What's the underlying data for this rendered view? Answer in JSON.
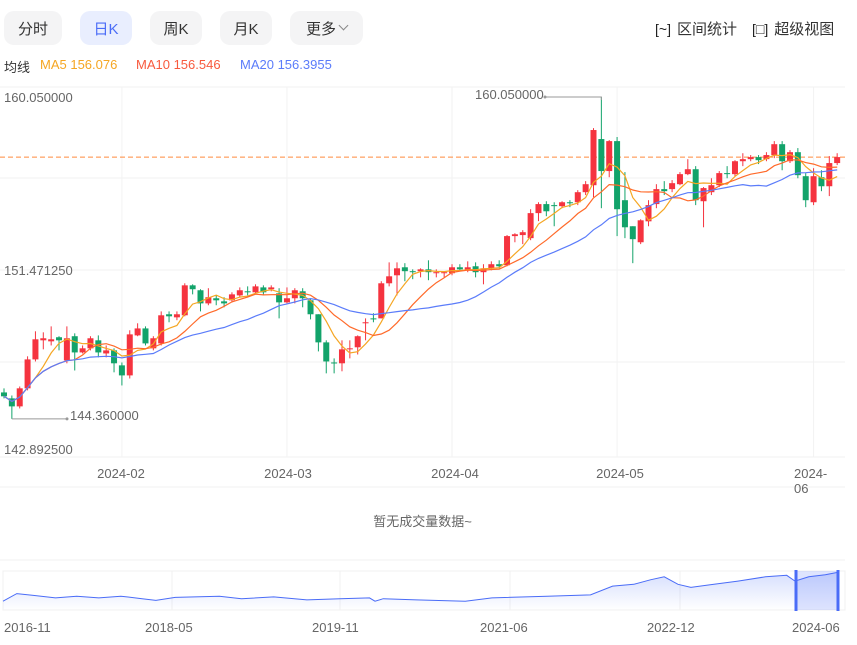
{
  "tabs": [
    {
      "label": "分时",
      "active": false
    },
    {
      "label": "日K",
      "active": true
    },
    {
      "label": "周K",
      "active": false
    },
    {
      "label": "月K",
      "active": false
    },
    {
      "label": "更多",
      "active": false
    }
  ],
  "tools": [
    {
      "icon": "range-stats-icon",
      "glyph": "[~]",
      "label": "区间统计"
    },
    {
      "icon": "fullscreen-view-icon",
      "glyph": "[□]",
      "label": "超级视图"
    }
  ],
  "ma_legend": {
    "title": "均线",
    "ma5": "MA5 156.076",
    "ma10": "MA10 156.546",
    "ma20": "MA20 156.3955"
  },
  "colors": {
    "up": "#f5333f",
    "down": "#12a36a",
    "ma5": "#f5a623",
    "ma10": "#ff6a2a",
    "ma20": "#5b7cfa",
    "accent": "#4a6cf7",
    "last_price_line": "#ff8a3d"
  },
  "volume_placeholder": "暂无成交量数据~",
  "chart_data": {
    "type": "candlestick",
    "y_ticks": [
      "160.050000",
      "151.471250",
      "142.892500"
    ],
    "ylim": [
      142.8925,
      160.05
    ],
    "x_tick_labels": [
      "2024-02",
      "2024-03",
      "2024-04",
      "2024-05",
      "2024-06"
    ],
    "x_tick_index": [
      15,
      36,
      57,
      78,
      103
    ],
    "annotations": {
      "max_label": "160.050000",
      "max_index": 76,
      "min_label": "144.360000",
      "min_index": 1
    },
    "last_price": 157.12,
    "ohlc_fields": [
      "open",
      "close",
      "high",
      "low"
    ],
    "ohlc": [
      [
        145.65,
        145.46,
        145.85,
        145.36
      ],
      [
        145.36,
        144.97,
        145.5,
        144.36
      ],
      [
        144.97,
        145.85,
        145.94,
        144.87
      ],
      [
        145.85,
        147.26,
        147.41,
        145.75
      ],
      [
        147.26,
        148.24,
        148.63,
        147.16
      ],
      [
        148.19,
        148.29,
        148.58,
        147.75
      ],
      [
        148.14,
        148.24,
        148.87,
        147.94
      ],
      [
        148.34,
        148.19,
        148.39,
        147.7
      ],
      [
        147.21,
        148.29,
        148.87,
        147.07
      ],
      [
        148.39,
        147.6,
        148.53,
        146.72
      ],
      [
        147.6,
        147.8,
        147.94,
        147.55
      ],
      [
        147.8,
        148.29,
        148.39,
        147.7
      ],
      [
        148.19,
        147.6,
        148.43,
        147.36
      ],
      [
        147.55,
        147.7,
        147.94,
        147.36
      ],
      [
        147.7,
        147.07,
        147.8,
        146.63
      ],
      [
        146.97,
        146.48,
        147.11,
        145.99
      ],
      [
        146.48,
        148.48,
        148.68,
        146.33
      ],
      [
        148.43,
        148.77,
        149.02,
        148.39
      ],
      [
        148.77,
        148.04,
        148.87,
        147.94
      ],
      [
        147.8,
        148.29,
        148.39,
        147.7
      ],
      [
        148.04,
        149.41,
        149.6,
        147.94
      ],
      [
        149.46,
        149.36,
        149.6,
        149.07
      ],
      [
        149.31,
        149.46,
        149.6,
        149.17
      ],
      [
        149.41,
        150.87,
        150.97,
        149.36
      ],
      [
        150.87,
        150.68,
        150.92,
        150.43
      ],
      [
        150.63,
        149.99,
        150.68,
        149.6
      ],
      [
        149.99,
        150.29,
        150.73,
        149.9
      ],
      [
        150.24,
        150.14,
        150.38,
        149.9
      ],
      [
        150.09,
        149.99,
        150.29,
        149.8
      ],
      [
        150.14,
        150.43,
        150.53,
        150.04
      ],
      [
        150.38,
        150.63,
        150.77,
        150.29
      ],
      [
        150.58,
        150.53,
        150.82,
        150.38
      ],
      [
        150.53,
        150.82,
        150.92,
        150.48
      ],
      [
        150.77,
        150.53,
        150.87,
        150.38
      ],
      [
        150.68,
        150.77,
        150.87,
        150.58
      ],
      [
        150.48,
        150.04,
        150.73,
        149.26
      ],
      [
        150.04,
        150.24,
        150.77,
        149.99
      ],
      [
        150.24,
        150.63,
        150.73,
        149.99
      ],
      [
        150.58,
        150.24,
        150.73,
        149.8
      ],
      [
        150.14,
        149.46,
        150.24,
        149.21
      ],
      [
        149.46,
        148.09,
        149.46,
        147.65
      ],
      [
        148.09,
        147.16,
        148.19,
        146.58
      ],
      [
        147.11,
        147.07,
        147.31,
        146.58
      ],
      [
        147.07,
        147.75,
        148.19,
        146.68
      ],
      [
        147.75,
        147.8,
        148.19,
        147.31
      ],
      [
        147.85,
        148.39,
        148.43,
        147.5
      ],
      [
        149.02,
        149.07,
        149.26,
        148.19
      ],
      [
        149.26,
        149.21,
        149.51,
        149.07
      ],
      [
        149.26,
        150.97,
        151.07,
        149.26
      ],
      [
        150.97,
        151.31,
        151.99,
        150.82
      ],
      [
        151.36,
        151.7,
        151.99,
        150.38
      ],
      [
        151.75,
        151.56,
        151.95,
        151.07
      ],
      [
        151.56,
        151.51,
        151.65,
        151.17
      ],
      [
        151.56,
        151.65,
        151.7,
        151.26
      ],
      [
        151.65,
        151.51,
        152.09,
        151.12
      ],
      [
        151.46,
        151.51,
        151.65,
        151.26
      ],
      [
        151.46,
        151.51,
        151.56,
        151.26
      ],
      [
        151.46,
        151.75,
        151.9,
        151.36
      ],
      [
        151.75,
        151.65,
        151.9,
        151.56
      ],
      [
        151.6,
        151.75,
        152.04,
        151.51
      ],
      [
        151.8,
        151.51,
        151.99,
        151.26
      ],
      [
        151.51,
        151.7,
        151.9,
        150.92
      ],
      [
        151.7,
        151.9,
        152.04,
        151.6
      ],
      [
        151.9,
        151.8,
        152.09,
        151.7
      ],
      [
        151.85,
        153.27,
        153.32,
        151.8
      ],
      [
        153.27,
        153.36,
        153.41,
        152.97
      ],
      [
        153.32,
        153.46,
        153.56,
        152.88
      ],
      [
        153.17,
        154.39,
        154.58,
        153.07
      ],
      [
        154.39,
        154.83,
        154.92,
        154.0
      ],
      [
        154.83,
        154.48,
        154.97,
        154.24
      ],
      [
        154.78,
        154.73,
        154.92,
        153.75
      ],
      [
        154.73,
        154.92,
        154.97,
        154.63
      ],
      [
        154.92,
        154.87,
        155.02,
        154.68
      ],
      [
        154.92,
        155.41,
        155.51,
        154.78
      ],
      [
        155.41,
        155.8,
        155.95,
        155.27
      ],
      [
        155.75,
        158.44,
        158.53,
        155.17
      ],
      [
        158.0,
        156.44,
        160.05,
        154.63
      ],
      [
        156.44,
        157.9,
        157.95,
        156.14
      ],
      [
        157.9,
        154.58,
        158.1,
        153.27
      ],
      [
        155.02,
        153.7,
        156.39,
        153.17
      ],
      [
        153.75,
        153.12,
        153.75,
        151.95
      ],
      [
        152.97,
        154.04,
        154.09,
        152.88
      ],
      [
        153.99,
        154.78,
        155.02,
        153.75
      ],
      [
        154.83,
        155.56,
        155.8,
        154.63
      ],
      [
        155.56,
        155.46,
        155.95,
        155.27
      ],
      [
        155.56,
        155.85,
        156.0,
        155.41
      ],
      [
        155.8,
        156.29,
        156.39,
        155.75
      ],
      [
        156.29,
        156.53,
        157.02,
        156.24
      ],
      [
        156.53,
        155.02,
        156.68,
        154.78
      ],
      [
        154.97,
        155.61,
        155.66,
        153.7
      ],
      [
        155.41,
        155.75,
        156.09,
        155.27
      ],
      [
        155.75,
        156.34,
        156.44,
        155.66
      ],
      [
        156.34,
        156.29,
        156.68,
        156.09
      ],
      [
        156.29,
        156.92,
        156.97,
        156.19
      ],
      [
        156.92,
        157.02,
        157.31,
        156.68
      ],
      [
        157.02,
        157.12,
        157.22,
        156.92
      ],
      [
        157.12,
        156.97,
        157.22,
        156.78
      ],
      [
        157.02,
        157.22,
        157.36,
        156.92
      ],
      [
        157.22,
        157.75,
        157.9,
        157.07
      ],
      [
        157.75,
        156.92,
        157.9,
        156.48
      ],
      [
        156.92,
        157.36,
        157.46,
        156.83
      ],
      [
        157.36,
        156.24,
        157.56,
        156.09
      ],
      [
        156.19,
        155.02,
        156.34,
        154.68
      ],
      [
        154.92,
        156.19,
        156.58,
        154.78
      ],
      [
        156.14,
        155.7,
        156.48,
        155.46
      ],
      [
        155.7,
        156.83,
        157.17,
        155.22
      ],
      [
        156.83,
        157.12,
        157.31,
        156.73
      ]
    ],
    "series": [
      {
        "name": "MA5",
        "period": 5
      },
      {
        "name": "MA10",
        "period": 10
      },
      {
        "name": "MA20",
        "period": 20
      }
    ],
    "navigator": {
      "type": "area",
      "x_tick_labels": [
        "2016-11",
        "2018-05",
        "2019-11",
        "2021-06",
        "2022-12",
        "2024-06"
      ],
      "month_offset": [
        0,
        1.5,
        3.3,
        5.7,
        8,
        10.4,
        12.8,
        15.1,
        16.6,
        18.7,
        23.5,
        25.9,
        29.4,
        33,
        36.6,
        39.8,
        40.4,
        41.3,
        44.9,
        50.2,
        53.1,
        59.1,
        63.8,
        66.2,
        68.5,
        70.3,
        71.8,
        73.3,
        74.7,
        76.8,
        79.8,
        82.8,
        85.1,
        86,
        87.5,
        89.3,
        90.7
      ],
      "values": [
        137,
        143,
        141.6,
        139.6,
        141,
        139.6,
        141,
        139,
        137.6,
        140,
        141,
        139,
        140.4,
        138,
        139,
        139.6,
        137,
        139,
        138,
        137,
        139.6,
        141,
        142,
        149,
        150.4,
        154,
        156.4,
        150.4,
        148,
        150,
        153,
        156.4,
        157.6,
        153,
        156.4,
        158,
        160
      ],
      "window": [
        "2024-01",
        "2024-06"
      ]
    }
  }
}
